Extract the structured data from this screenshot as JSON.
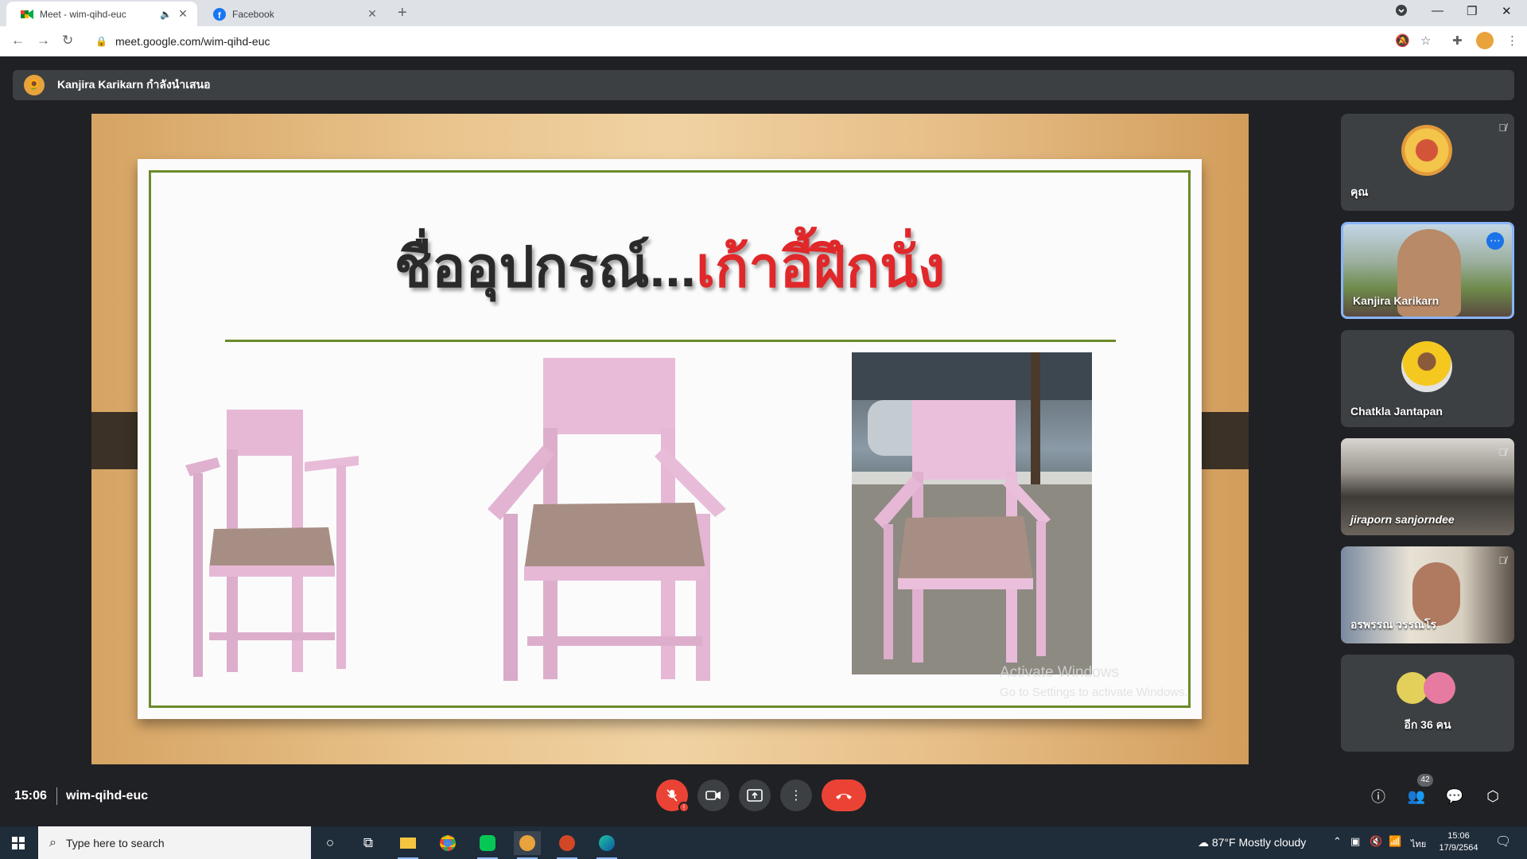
{
  "browser": {
    "tabs": [
      {
        "title": "Meet - wim-qihd-euc",
        "icon": "google-meet-icon",
        "audio_icon": "speaker-icon",
        "active": true
      },
      {
        "title": "Facebook",
        "icon": "facebook-icon",
        "active": false
      }
    ],
    "new_tab_symbol": "+",
    "url": "meet.google.com/wim-qihd-euc"
  },
  "meet": {
    "presenter_banner": "Kanjira Karikarn กำลังนำเสนอ",
    "slide": {
      "title_prefix": "ชื่ออุปกรณ์...",
      "title_highlight": "เก้าอี้ฝึกนั่ง",
      "colors": {
        "title": "#2a2a2a",
        "highlight": "#e0282a",
        "frame": "#6b8a2a",
        "chair": "#e9bdd9",
        "seat": "#a88f84"
      }
    },
    "watermark": {
      "line1": "Activate Windows",
      "line2": "Go to Settings to activate Windows."
    },
    "participants": [
      {
        "name": "คุณ",
        "muted": true
      },
      {
        "name": "Kanjira Karikarn",
        "more_icon": "more-options-icon",
        "active": true
      },
      {
        "name": "Chatkla Jantapan",
        "muted": false
      },
      {
        "name": "jiraporn sanjorndee",
        "muted": true
      },
      {
        "name": "อรพรรณ วรรณโร",
        "muted": true
      },
      {
        "name": "อีก 36 คน"
      }
    ],
    "controls": {
      "time": "15:06",
      "meeting_code": "wim-qihd-euc",
      "people_count": "42"
    }
  },
  "taskbar": {
    "search_placeholder": "Type here to search",
    "weather": "87°F  Mostly cloudy",
    "lang": "ไทย",
    "clock_time": "15:06",
    "clock_date": "17/9/2564"
  }
}
